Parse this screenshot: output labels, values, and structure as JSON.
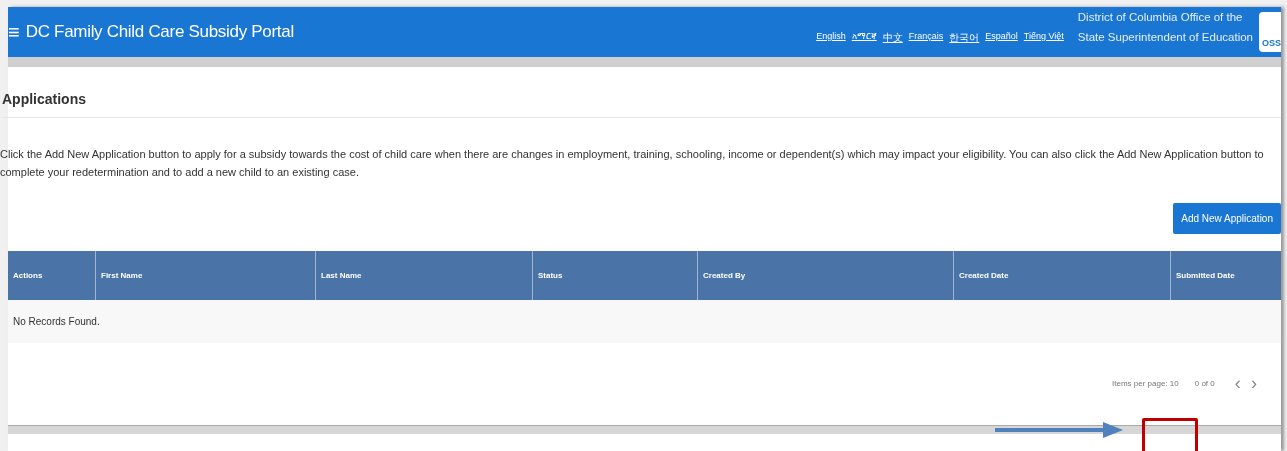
{
  "header": {
    "menu_glyph": "≡",
    "title": "DC Family Child Care Subsidy Portal",
    "languages": [
      "English",
      "አማርኛ",
      "中文",
      "Français",
      "한국어",
      "Español",
      "Tiếng Việt"
    ],
    "agency_lines": [
      "District of Columbia Office of the",
      "State Superintendent of Education"
    ],
    "logo_text": "OSS"
  },
  "page": {
    "title": "Applications",
    "description": "Click the Add New Application button to apply for a subsidy towards the cost of child care when there are changes in employment, training, schooling, income or dependent(s) which may impact your eligibility. You can also click the Add New Application button to complete your redetermination and to add a new child to an existing case.",
    "add_button": "Add New Application"
  },
  "table": {
    "columns": [
      "Actions",
      "First Name",
      "Last Name",
      "Status",
      "Created By",
      "Created Date",
      "Submitted Date"
    ],
    "empty_message": "No Records Found."
  },
  "paginator": {
    "items_per_page": "Items per page: 10",
    "range": "0 of 0",
    "prev_glyph": "‹",
    "next_glyph": "›"
  }
}
